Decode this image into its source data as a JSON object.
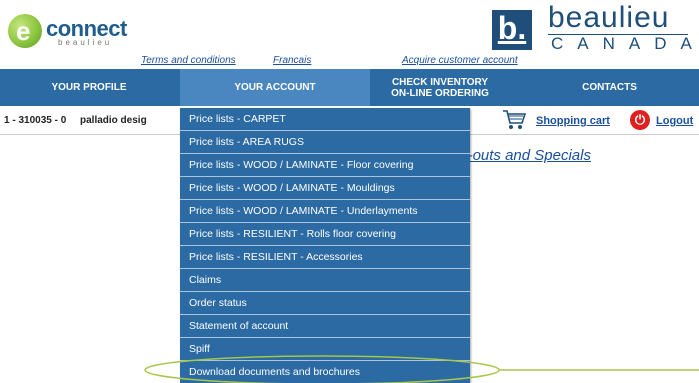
{
  "header": {
    "econnect_brand": "connect",
    "econnect_sub": "beaulieu",
    "econnect_icon": "e-circle-logo-icon",
    "beaulieu_brand": "beaulieu",
    "beaulieu_sub": "CANADA",
    "links": {
      "terms": "Terms and conditions",
      "french": "Francais",
      "acquire": "Acquire customer account"
    }
  },
  "nav": {
    "profile": "YOUR PROFILE",
    "account": "YOUR ACCOUNT",
    "inventory_line1": "CHECK INVENTORY",
    "inventory_line2": "ON-LINE ORDERING",
    "contacts": "CONTACTS"
  },
  "account_bar": {
    "number": "1 - 310035 - 0",
    "name": "palladio desig",
    "cart": "Shopping cart",
    "logout": "Logout",
    "cart_icon": "shopping-cart-icon",
    "logout_icon": "power-icon"
  },
  "promo_link": "Clear-outs and Specials",
  "dropdown_items": [
    "Price lists - CARPET",
    "Price lists - AREA RUGS",
    "Price lists - WOOD / LAMINATE - Floor covering",
    "Price lists - WOOD / LAMINATE - Mouldings",
    "Price lists - WOOD / LAMINATE - Underlayments",
    "Price lists - RESILIENT - Rolls floor covering",
    "Price lists - RESILIENT - Accessories",
    "Claims",
    "Order status",
    "Statement of account",
    "Spiff",
    "Download documents and brochures"
  ],
  "colors": {
    "nav_bg": "#2b6aa3",
    "link": "#1b4f9c",
    "highlight": "#a8c64a"
  }
}
